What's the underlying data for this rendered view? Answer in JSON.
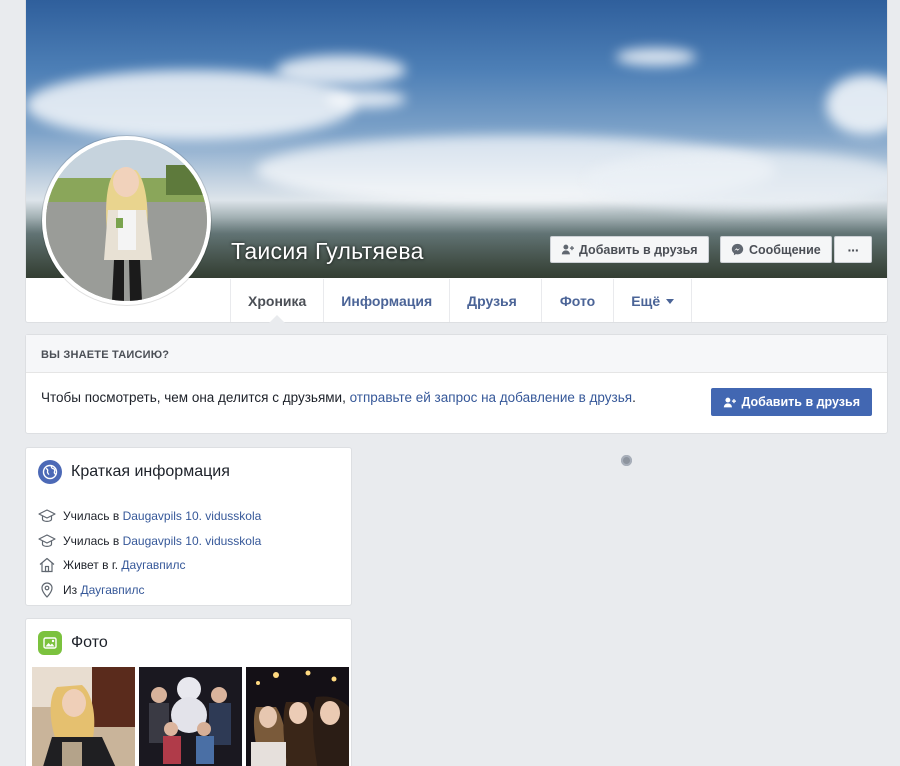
{
  "profile": {
    "name": "Таисия Гультяева",
    "add_friend_label": "Добавить в друзья",
    "message_label": "Сообщение",
    "more_label": "···"
  },
  "tabs": [
    {
      "label": "Хроника",
      "active": true
    },
    {
      "label": "Информация"
    },
    {
      "label": "Друзья"
    },
    {
      "label": "Фото"
    },
    {
      "label": "Ещё"
    }
  ],
  "know": {
    "title": "ВЫ ЗНАЕТЕ ТАИСИЮ?",
    "text_before": "Чтобы посмотреть, чем она делится с друзьями, ",
    "link": "отправьте ей запрос на добавление в друзья",
    "text_after": ".",
    "button_label": "Добавить в друзья"
  },
  "intro": {
    "title": "Краткая информация",
    "items": [
      {
        "icon": "graduation-cap-icon",
        "prefix": "Училась в ",
        "link": "Daugavpils 10. vidusskola"
      },
      {
        "icon": "graduation-cap-icon",
        "prefix": "Училась в ",
        "link": "Daugavpils 10. vidusskola"
      },
      {
        "icon": "home-icon",
        "prefix": "Живет в г. ",
        "link": "Даугавпилс"
      },
      {
        "icon": "location-pin-icon",
        "prefix": "Из ",
        "link": "Даугавпилс"
      }
    ]
  },
  "photos": {
    "title": "Фото"
  },
  "colors": {
    "brand_blue": "#4267b2",
    "link_blue": "#365899",
    "page_bg": "#e9ebee",
    "intro_icon": "#4c69b6",
    "photo_icon": "#7bc23e"
  }
}
